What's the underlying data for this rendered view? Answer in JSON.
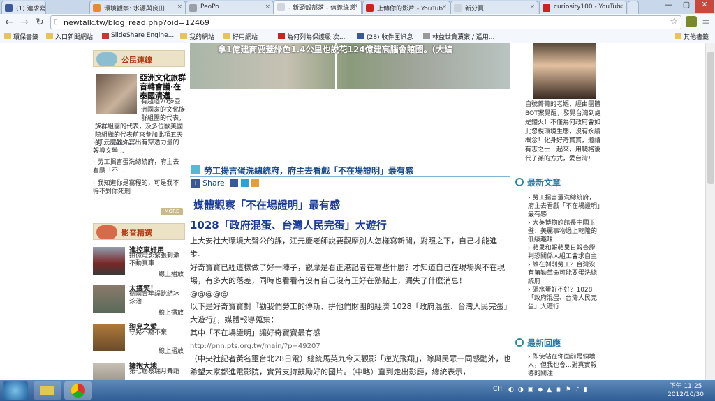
{
  "tabs": [
    {
      "label": "(1) 連求寫",
      "color": "#3b5998"
    },
    {
      "label": "環境觀察: 水源與良田",
      "color": "#e98a30"
    },
    {
      "label": "PeoPo",
      "color": "#9aa0a8"
    },
    {
      "label": "- 新頭殼部落 - 信義綠意",
      "color": "#cfd6de"
    },
    {
      "label": "上傳你的影片 - YouTub",
      "color": "#cc2222"
    },
    {
      "label": "新分頁",
      "color": "#c9d2dd"
    },
    {
      "label": "curiosity100 - YouTub",
      "color": "#cc2222"
    }
  ],
  "address": {
    "url": "newtalk.tw/blog_read.php?oid=12469"
  },
  "bookmarks": [
    "環保書籤",
    "入口新聞網站",
    "SlideShare Engine...",
    "我的網站",
    "好用網站",
    "為何列為保護級 次...",
    "(28) 收件匣訊息",
    "林益世貪瀆案 / 遙用...",
    "其他書籤"
  ],
  "banner": {
    "caption": "拿1億建商要蓋綠色1.4公里也說花124億建高腦會館圈。(大編"
  },
  "left": {
    "citizen_title": "公民連線",
    "feature_title": "亞洲文化旅群音韓會議·在泰國清邁",
    "feature_desc": "有超過20多亞洲國家的文化族群組團的代表，及多位歐美國際組織的代表前來參加此項五天的",
    "feature_more": "......more",
    "items": [
      "江元慶教你寫出有穿透力量的報導文學...",
      "勞工揭言蛋洗總統府，府主去看戲「不...",
      "我知道你是寫程的，可是我不得不對你死刑"
    ],
    "more_label": "MORE",
    "video_title": "影音精選",
    "videos": [
      {
        "title": "進控車好用",
        "desc": "拍微電影緊張刺激不動真車",
        "play": "線上播放"
      },
      {
        "title": "太搞笑！",
        "desc": "德國青年誤跳結冰泳池",
        "play": "線上播放"
      },
      {
        "title": "狗兒之愛",
        "desc": "守晃不離不棄",
        "play": "線上播放"
      },
      {
        "title": "擁抱大地",
        "desc": "第七屆蔡瑞月舞蹈"
      }
    ]
  },
  "article": {
    "heading": "勞工揚言蛋洗總統府，府主去看戲「不在場證明」最有感",
    "share": "Share",
    "title1": "媒體觀察「不在場證明」最有感",
    "title2": "1028「政府混蛋、台灣人民完蛋」大遊行",
    "p1": "上大安社大環境大聲公的課，江元慶老師說要觀摩別人怎樣寫新聞，對照之下，自己才能進步。",
    "p2": "好奇寶寶已經這樣做了好一陣子，觀摩是看正港記者在寫些什麼？才知道自己在現場與不在現場，有多大的落差，同時也看看有沒有自己沒有正好在熟點上，漏失了什麼消息！",
    "p3": "@@@@@",
    "p4": "以下是好奇寶寶對『勸我們勞工的傳斯、拚他們財團的經濟 1028「政府混蛋、台灣人民完蛋」大遊行』，媒體報導蒐集：",
    "p5": "其中「不在場證明」讓好奇寶寶最有感",
    "link": "http://pnn.pts.org.tw/main/?p=49207",
    "p6": "（中央社記者黃名璽台北28日電）總統馬英九今天觀影「逆光飛翔」，除與民眾一同感動外，也希望大家都進電影院，實質支持鼓勵好的國片。（中略）直到走出影廳，總統表示，"
  },
  "right": {
    "bio": "自號菁菁的老嫗，經由團體BOT案覺醒，發覺台灣到處是鐘火！不僅為何政府會如此忽視環境生態，沒有永續概念！化身好奇寶寶，邀請有志之士一起來，用爬格後代子孫的方式，愛台灣！",
    "latest_title": "最新文章",
    "latest": [
      "勞工揚言蛋洗總統府，府主去看戲「不在場證明」最有感",
      "大英博物館館長中國玉璧：美麗事物過上乾隆的低級趣味",
      "蘋果和報蘋果日報查證判恐關係人組工會求自主",
      "誰在剝削勞工？台灣沒有第勒革命可能要蛋洗總統府",
      "砸水蛋好不好？1028「政府混蛋、台灣人民完蛋」大遊行"
    ],
    "reply_title": "最新回應",
    "replies": [
      "即使站在你面前是個壞人，但我也會...對真實報導的關注"
    ]
  },
  "taskbar": {
    "time": "下午 11:25",
    "date": "2012/10/30",
    "lang": "CH"
  }
}
